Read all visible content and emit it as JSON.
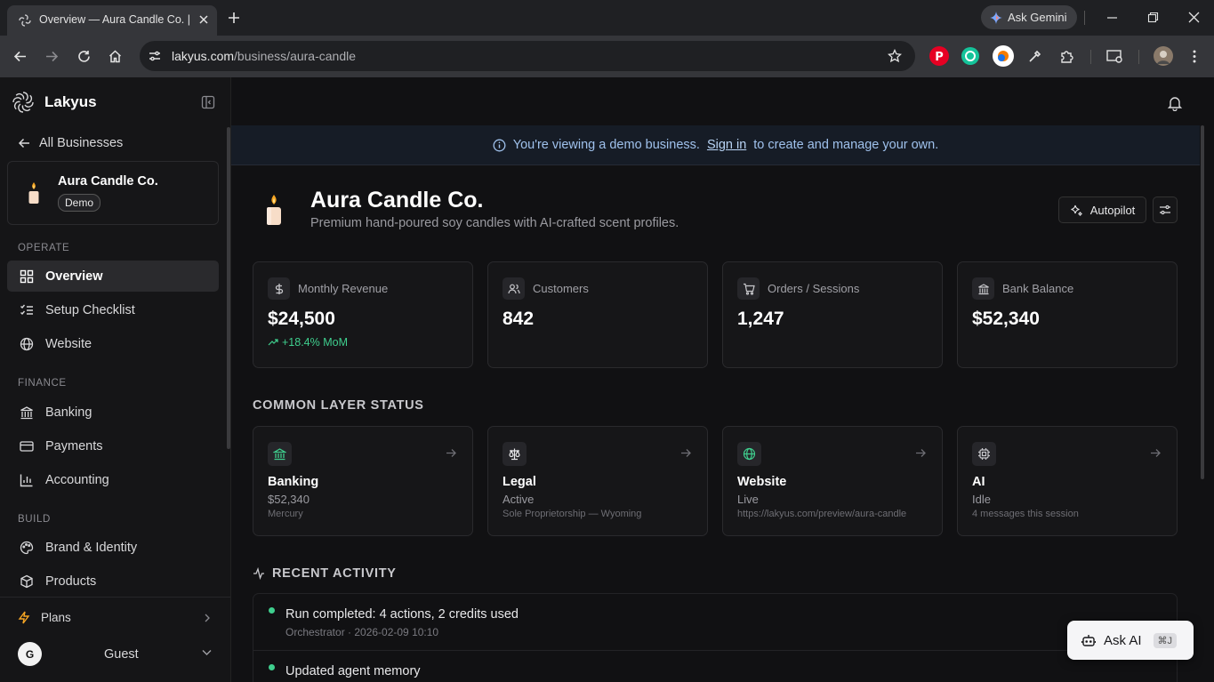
{
  "browser": {
    "tab_title": "Overview — Aura Candle Co. | L",
    "url_domain": "lakyus.com",
    "url_path": "/business/aura-candle",
    "gemini_label": "Ask Gemini"
  },
  "sidebar": {
    "brand": "Lakyus",
    "back_label": "All Businesses",
    "business": {
      "name": "Aura Candle Co.",
      "badge": "Demo"
    },
    "sections": [
      {
        "title": "OPERATE",
        "items": [
          {
            "label": "Overview",
            "icon": "grid-icon",
            "active": true
          },
          {
            "label": "Setup Checklist",
            "icon": "checklist-icon"
          },
          {
            "label": "Website",
            "icon": "globe-icon"
          }
        ]
      },
      {
        "title": "FINANCE",
        "items": [
          {
            "label": "Banking",
            "icon": "bank-icon"
          },
          {
            "label": "Payments",
            "icon": "credit-card-icon"
          },
          {
            "label": "Accounting",
            "icon": "bar-chart-icon"
          }
        ]
      },
      {
        "title": "BUILD",
        "items": [
          {
            "label": "Brand & Identity",
            "icon": "palette-icon"
          },
          {
            "label": "Products",
            "icon": "package-icon"
          }
        ]
      }
    ],
    "plans_label": "Plans",
    "user": {
      "initial": "G",
      "name": "Guest"
    }
  },
  "banner": {
    "text_before": "You're viewing a demo business.",
    "link": "Sign in",
    "text_after": "to create and manage your own."
  },
  "header": {
    "title": "Aura Candle Co.",
    "subtitle": "Premium hand-poured soy candles with AI-crafted scent profiles.",
    "autopilot_label": "Autopilot"
  },
  "stats": [
    {
      "label": "Monthly Revenue",
      "value": "$24,500",
      "delta": "+18.4% MoM",
      "icon": "dollar-icon"
    },
    {
      "label": "Customers",
      "value": "842",
      "icon": "users-icon"
    },
    {
      "label": "Orders / Sessions",
      "value": "1,247",
      "icon": "cart-icon"
    },
    {
      "label": "Bank Balance",
      "value": "$52,340",
      "icon": "bank-icon"
    }
  ],
  "common_layer": {
    "title": "COMMON LAYER STATUS",
    "cards": [
      {
        "name": "Banking",
        "status": "$52,340",
        "detail": "Mercury",
        "icon": "bank-icon",
        "color": "#3fcf8e"
      },
      {
        "name": "Legal",
        "status": "Active",
        "detail": "Sole Proprietorship — Wyoming",
        "icon": "scale-icon",
        "color": "#e8e8ea"
      },
      {
        "name": "Website",
        "status": "Live",
        "detail": "https://lakyus.com/preview/aura-candle",
        "icon": "globe-icon",
        "color": "#3fcf8e"
      },
      {
        "name": "AI",
        "status": "Idle",
        "detail": "4 messages this session",
        "icon": "cpu-icon",
        "color": "#c8c8cc"
      }
    ]
  },
  "recent_activity": {
    "title": "RECENT ACTIVITY",
    "items": [
      {
        "title": "Run completed: 4 actions, 2 credits used",
        "meta": "Orchestrator · 2026-02-09 10:10"
      },
      {
        "title": "Updated agent memory",
        "meta": ""
      }
    ]
  },
  "ask_ai": {
    "label": "Ask AI",
    "shortcut": "⌘J"
  }
}
